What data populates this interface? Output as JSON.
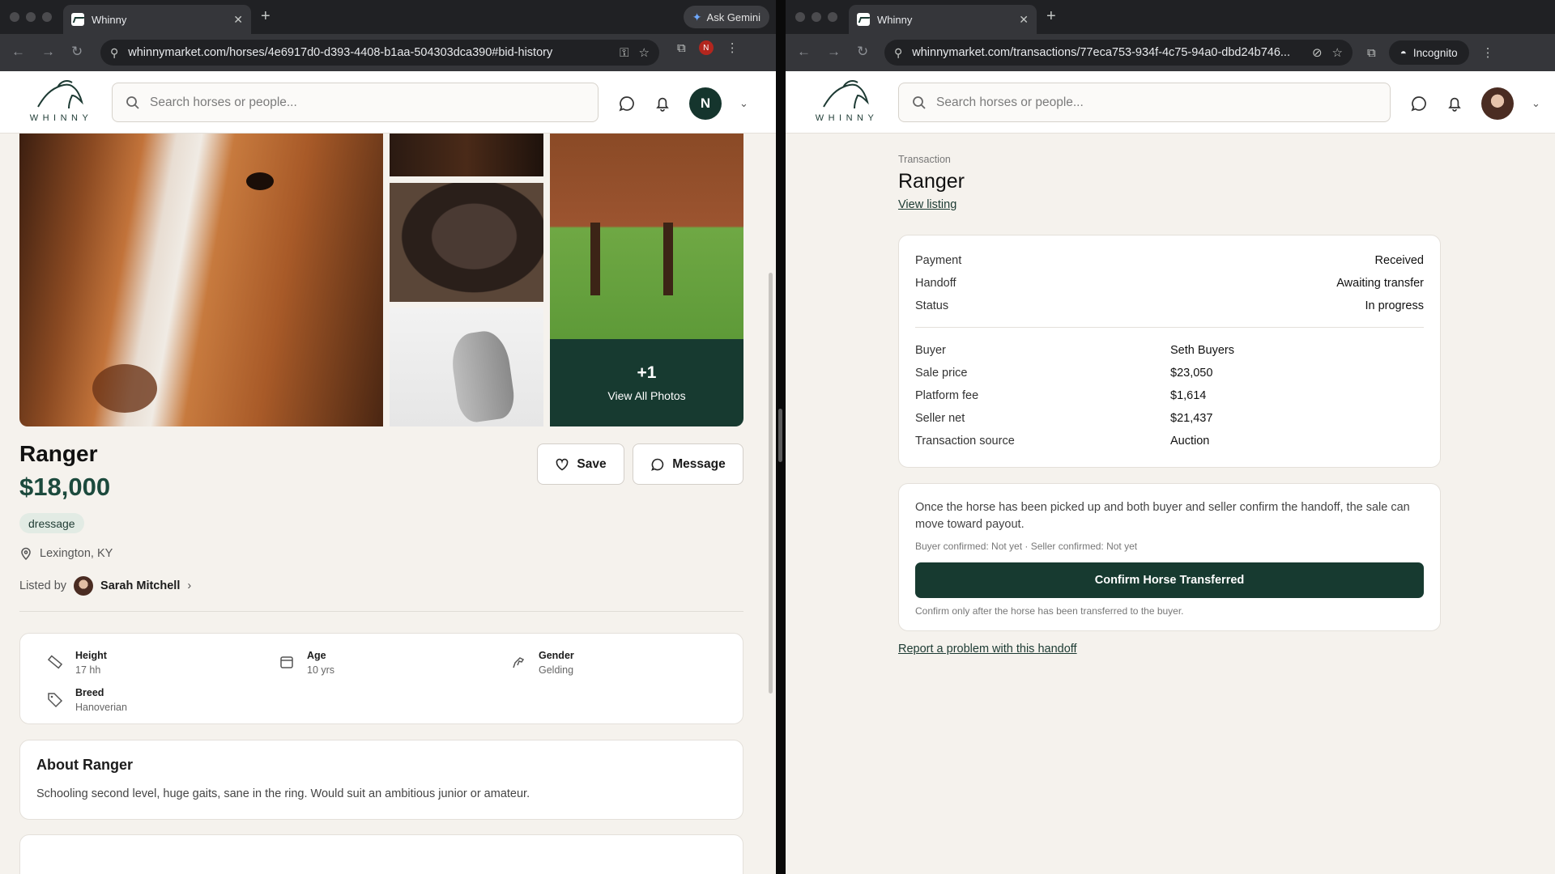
{
  "left": {
    "tab_title": "Whinny",
    "url": "whinnymarket.com/horses/4e6917d0-d393-4408-b1aa-504303dca390#bid-history",
    "gemini_label": "Ask Gemini",
    "profile_initial": "N",
    "logo_text": "WHINNY",
    "search_placeholder": "Search horses or people...",
    "user_initial": "N",
    "gallery": {
      "more_count": "+1",
      "more_label": "View All Photos"
    },
    "listing": {
      "name": "Ranger",
      "price": "$18,000",
      "tag": "dressage",
      "location": "Lexington, KY",
      "listed_by_label": "Listed by",
      "seller": "Sarah Mitchell",
      "save_label": "Save",
      "message_label": "Message"
    },
    "stats": [
      {
        "label": "Height",
        "value": "17 hh"
      },
      {
        "label": "Age",
        "value": "10 yrs"
      },
      {
        "label": "Gender",
        "value": "Gelding"
      },
      {
        "label": "Breed",
        "value": "Hanoverian"
      }
    ],
    "about": {
      "title": "About Ranger",
      "text": "Schooling second level, huge gaits, sane in the ring. Would suit an ambitious junior or amateur."
    }
  },
  "right": {
    "tab_title": "Whinny",
    "url": "whinnymarket.com/transactions/77eca753-934f-4c75-94a0-dbd24b746...",
    "incognito_label": "Incognito",
    "logo_text": "WHINNY",
    "search_placeholder": "Search horses or people...",
    "transaction": {
      "kicker": "Transaction",
      "title": "Ranger",
      "view_listing": "View listing",
      "status_rows": [
        {
          "label": "Payment",
          "value": "Received"
        },
        {
          "label": "Handoff",
          "value": "Awaiting transfer"
        },
        {
          "label": "Status",
          "value": "In progress"
        }
      ],
      "detail_rows": [
        {
          "label": "Buyer",
          "value": "Seth Buyers"
        },
        {
          "label": "Sale price",
          "value": "$23,050"
        },
        {
          "label": "Platform fee",
          "value": "$1,614"
        },
        {
          "label": "Seller net",
          "value": "$21,437"
        },
        {
          "label": "Transaction source",
          "value": "Auction"
        }
      ],
      "handoff_note": "Once the horse has been picked up and both buyer and seller confirm the handoff, the sale can move toward payout.",
      "confirm_status": "Buyer confirmed: Not yet · Seller confirmed: Not yet",
      "confirm_button": "Confirm Horse Transferred",
      "confirm_hint": "Confirm only after the horse has been transferred to the buyer.",
      "report_link": "Report a problem with this handoff"
    }
  },
  "colors": {
    "brand_dark": "#173a30",
    "background": "#f5f2ed",
    "tag_bg": "#e2ebe4"
  },
  "icons": [
    "search-icon",
    "chat-icon",
    "bell-icon",
    "heart-icon",
    "location-pin-icon",
    "ruler-icon",
    "calendar-icon",
    "horse-icon",
    "tag-icon",
    "star-icon",
    "key-icon",
    "extensions-icon",
    "incognito-icon"
  ]
}
